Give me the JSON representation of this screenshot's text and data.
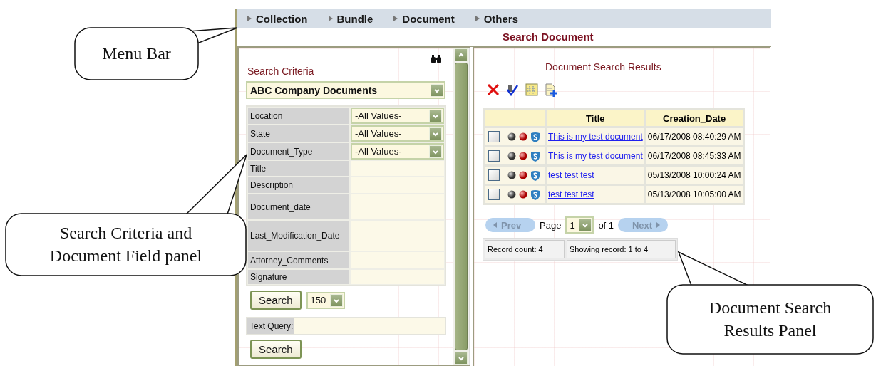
{
  "menu_bar": {
    "items": [
      {
        "label": "Collection"
      },
      {
        "label": "Bundle"
      },
      {
        "label": "Document"
      },
      {
        "label": "Others"
      }
    ]
  },
  "page_title": "Search Document",
  "search_panel": {
    "heading": "Search Criteria",
    "collection_select": "ABC Company Documents",
    "fields": [
      {
        "label": "Location",
        "kind": "select",
        "value": "-All Values-"
      },
      {
        "label": "State",
        "kind": "select",
        "value": "-All Values-"
      },
      {
        "label": "Document_Type",
        "kind": "select",
        "value": "-All Values-"
      },
      {
        "label": "Title",
        "kind": "text"
      },
      {
        "label": "Description",
        "kind": "text"
      },
      {
        "label": "Document_date",
        "kind": "text"
      },
      {
        "label": "Last_Modification_Date",
        "kind": "text"
      },
      {
        "label": "Attorney_Comments",
        "kind": "text"
      },
      {
        "label": "Signature",
        "kind": "text"
      }
    ],
    "search_button": "Search",
    "limit_select": "150",
    "text_query_label": "Text Query:",
    "text_search_button": "Search"
  },
  "results_panel": {
    "heading": "Document Search Results",
    "table": {
      "columns": [
        "Title",
        "Creation_Date"
      ],
      "rows": [
        {
          "checked": false,
          "title": "This is my test document",
          "creation_date": "06/17/2008 08:40:29 AM"
        },
        {
          "checked": false,
          "title": "This is my test document",
          "creation_date": "06/17/2008 08:45:33 AM"
        },
        {
          "checked": false,
          "title": "test test test",
          "creation_date": "05/13/2008 10:00:24 AM"
        },
        {
          "checked": false,
          "title": "test test test",
          "creation_date": "05/13/2008 10:05:00 AM"
        }
      ]
    },
    "pagination": {
      "prev": {
        "label": "Prev",
        "disabled": true
      },
      "page_label": "Page",
      "page_select": "1",
      "of_label": "of 1",
      "next": {
        "label": "Next",
        "disabled": true
      }
    },
    "record_count": "Record count: 4",
    "showing": "Showing record: 1 to 4"
  },
  "callouts": [
    {
      "text": "Menu Bar"
    },
    {
      "text": "Search Criteria and Document Field panel"
    },
    {
      "text": "Document Search Results Panel"
    }
  ]
}
